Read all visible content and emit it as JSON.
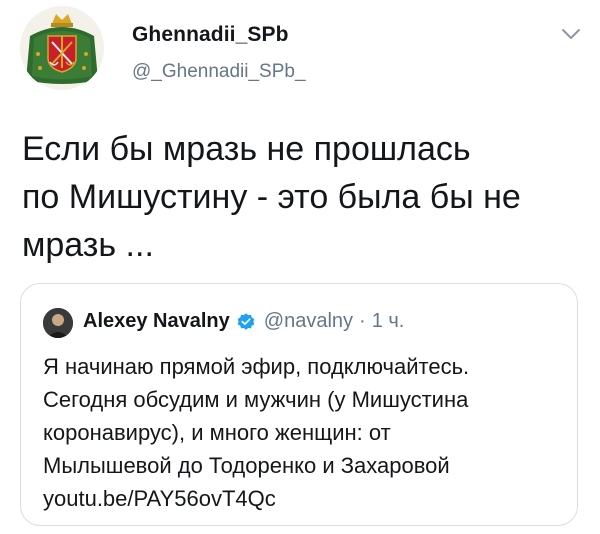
{
  "tweet": {
    "author": {
      "name": "Ghennadii_SPb",
      "handle": "@_Ghennadii_SPb_"
    },
    "text_lines": [
      "Если бы мразь не прошлась",
      "по Мишустину - это была бы не",
      "мразь ..."
    ],
    "quoted": {
      "author_name": "Alexey Navalny",
      "handle": "@navalny",
      "separator": "·",
      "time": "1 ч.",
      "text_lines": [
        "Я начинаю прямой эфир, подключайтесь.",
        "Сегодня обсудим и мужчин (у Мишустина",
        "коронавирус), и много женщин: от",
        "Мылышевой до Тодоренко и Захаровой",
        "youtu.be/PAY56ovT4Qc"
      ]
    }
  },
  "icons": {
    "avatar": "st-petersburg-coat-of-arms-icon",
    "menu": "chevron-down-icon",
    "verified": "verified-badge-icon"
  },
  "colors": {
    "text": "#14171a",
    "secondary": "#657786",
    "border": "#d8dee3",
    "verified": "#1da1f2",
    "emblem_red": "#c8202a",
    "emblem_green": "#2e6b2c",
    "emblem_gold": "#d9a626"
  }
}
